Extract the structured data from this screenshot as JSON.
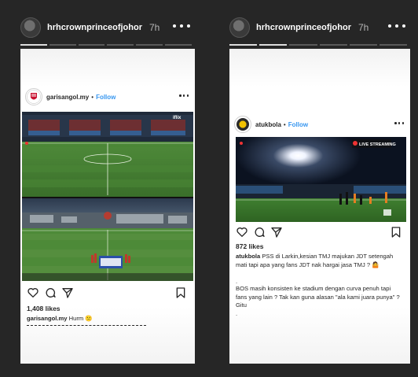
{
  "left_story": {
    "username": "hrhcrownprinceofjohor",
    "time": "7h",
    "post": {
      "username": "garisangol.my",
      "follow_label": "Follow",
      "likes": "1,408 likes",
      "caption_user": "garisangol.my",
      "caption_text": "Hurm",
      "caption_emoji": "😕",
      "media_watermark": "iflix"
    }
  },
  "right_story": {
    "username": "hrhcrownprinceofjohor",
    "time": "7h",
    "post": {
      "username": "atukbola",
      "follow_label": "Follow",
      "likes": "872 likes",
      "caption_user": "atukbola",
      "caption_text": "PSS di Larkin,kesian TMJ majukan JDT setengah mati tapi apa yang fans JDT nak hargai jasa TMJ ?",
      "caption_line2": "BOS masih konsisten ke stadium dengan curva penuh tapi fans yang lain ? Tak kan guna alasan \"ala kami juara punya\" ? Gitu",
      "caption_dot": ".",
      "media_watermark": "LIVE STREAMING"
    }
  },
  "colors": {
    "background": "#262626",
    "follow": "#3897f0",
    "pitch": "#3f7a2d"
  },
  "icons": [
    "heart-icon",
    "comment-icon",
    "share-icon",
    "bookmark-icon",
    "more-icon"
  ]
}
